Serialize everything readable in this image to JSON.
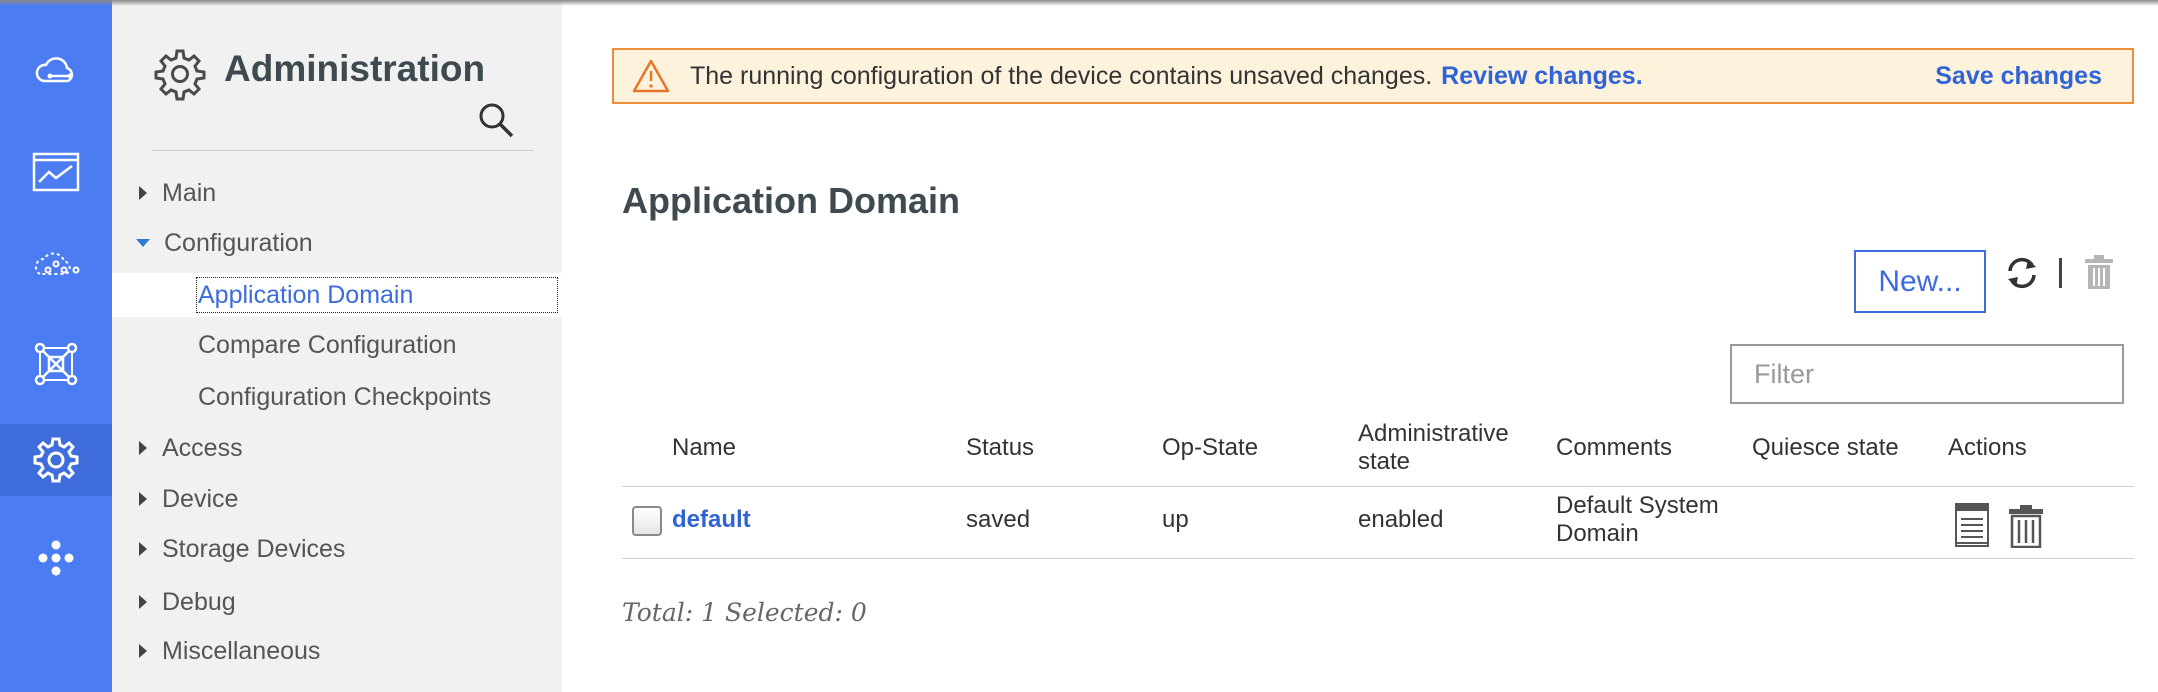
{
  "colors": {
    "rail": "#4b7cf2",
    "rail_active": "#3f6edc",
    "link": "#2f63d6",
    "banner_bg": "#fdf3dc",
    "banner_border": "#f08a3c"
  },
  "rail": {
    "items": [
      {
        "icon": "cloud-connect-icon"
      },
      {
        "icon": "monitor-chart-icon"
      },
      {
        "icon": "cloud-network-icon"
      },
      {
        "icon": "topology-icon"
      },
      {
        "icon": "gear-icon",
        "active": true
      },
      {
        "icon": "apps-dots-icon"
      }
    ]
  },
  "nav": {
    "title": "Administration",
    "items": [
      {
        "label": "Main",
        "expanded": false
      },
      {
        "label": "Configuration",
        "expanded": true,
        "children": [
          "Application Domain",
          "Compare Configuration",
          "Configuration Checkpoints"
        ]
      },
      {
        "label": "Access",
        "expanded": false
      },
      {
        "label": "Device",
        "expanded": false
      },
      {
        "label": "Storage Devices",
        "expanded": false
      },
      {
        "label": "Debug",
        "expanded": false
      },
      {
        "label": "Miscellaneous",
        "expanded": false
      }
    ],
    "selected": "Application Domain"
  },
  "banner": {
    "message": "The running configuration of the device contains unsaved changes.",
    "review_link": "Review changes.",
    "save_link": "Save changes"
  },
  "page": {
    "title": "Application Domain",
    "new_button": "New...",
    "filter_placeholder": "Filter"
  },
  "table": {
    "columns": [
      "Name",
      "Status",
      "Op-State",
      "Administrative state",
      "Comments",
      "Quiesce state",
      "Actions"
    ],
    "column_lines": {
      "administrative_state": [
        "Administrative",
        "state"
      ]
    },
    "rows": [
      {
        "name": "default",
        "status": "saved",
        "op_state": "up",
        "admin_state": "enabled",
        "comments_lines": [
          "Default System",
          "Domain"
        ],
        "quiesce_state": "",
        "checked": false
      }
    ],
    "footer": "Total: 1 Selected: 0"
  }
}
